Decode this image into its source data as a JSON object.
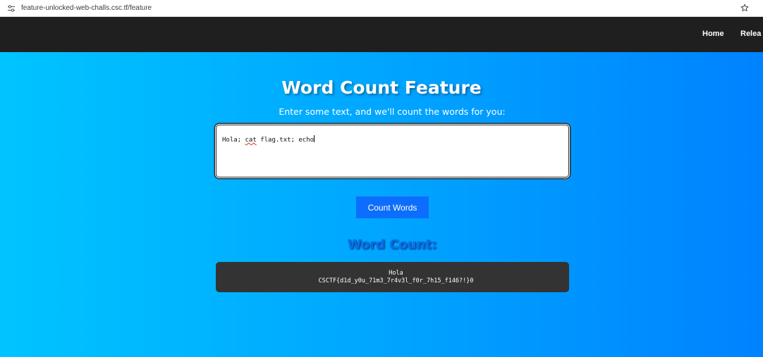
{
  "browser": {
    "url": "feature-unlocked-web-challs.csc.tf/feature",
    "site_info_icon": "tune-icon",
    "bookmark_icon": "star-outline-icon"
  },
  "nav": {
    "links": [
      "Home",
      "Relea"
    ]
  },
  "page": {
    "title": "Word Count Feature",
    "subtitle": "Enter some text, and we'll count the words for you:",
    "textarea_before_flagged": "Hola; ",
    "textarea_flagged_word": "cat",
    "textarea_after_flagged": " flag.txt; echo",
    "button_label": "Count Words",
    "result_heading": "Word Count:",
    "result_lines": [
      "Hola",
      "CSCTF{d1d_y0u_71m3_7r4v3l_f0r_7h15_f146?!}0"
    ]
  },
  "colors": {
    "navbar": "#1f1f1f",
    "gradient_start": "#00c4ff",
    "gradient_end": "#0082ff",
    "button": "#0d6efd",
    "result_box": "#333333",
    "result_heading": "#0a6ee8"
  }
}
